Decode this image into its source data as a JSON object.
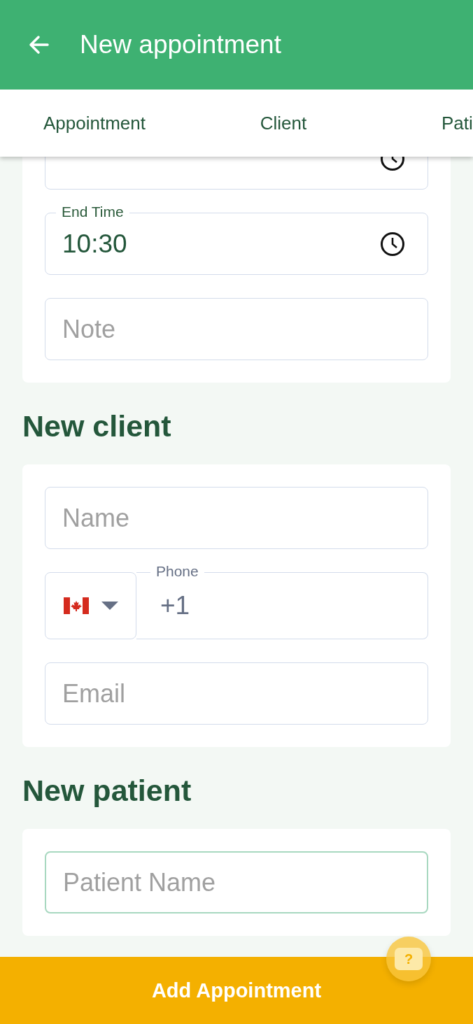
{
  "header": {
    "title": "New appointment"
  },
  "tabs": [
    {
      "label": "Appointment"
    },
    {
      "label": "Client"
    },
    {
      "label": "Pati"
    }
  ],
  "sections": [
    {
      "fields": [
        {
          "kind": "time"
        },
        {
          "kind": "time",
          "label": "End Time",
          "value": "10:30"
        },
        {
          "kind": "text",
          "placeholder": "Note"
        }
      ]
    },
    {
      "heading": "New client",
      "fields": [
        {
          "kind": "text",
          "placeholder": "Name"
        },
        {
          "kind": "phone",
          "label": "Phone",
          "value": "+1"
        },
        {
          "kind": "text",
          "placeholder": "Email"
        }
      ]
    },
    {
      "heading": "New patient",
      "fields": [
        {
          "kind": "text",
          "placeholder": "Patient Name",
          "focused": true
        }
      ]
    }
  ],
  "help": {
    "icon": "?"
  },
  "submit": "Add Appointment"
}
